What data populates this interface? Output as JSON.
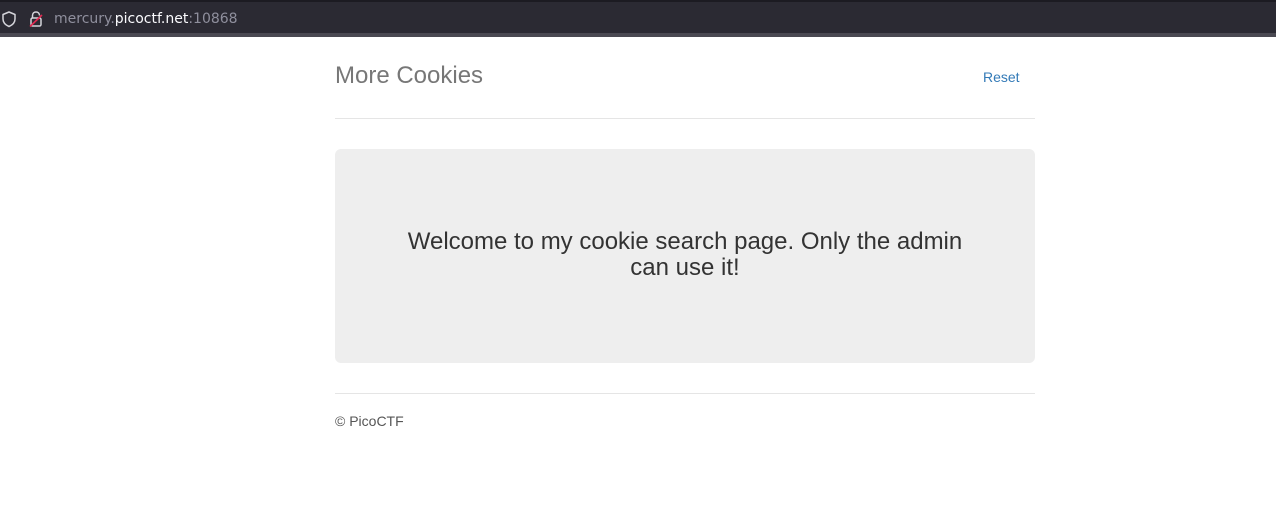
{
  "browser": {
    "url_subdomain": "mercury.",
    "url_domain": "picoctf.net",
    "url_port": ":10868",
    "icons": [
      "shield-icon",
      "lock-insecure-icon"
    ]
  },
  "header": {
    "title": "More Cookies",
    "reset_label": "Reset"
  },
  "jumbotron": {
    "line1": "Welcome to my cookie search page. Only the admin",
    "line2": "can use it!"
  },
  "footer": {
    "text": "© PicoCTF"
  },
  "colors": {
    "link": "#337ab7",
    "jumbotron_bg": "#eeeeee",
    "urlbar_bg": "#2b2a33"
  }
}
